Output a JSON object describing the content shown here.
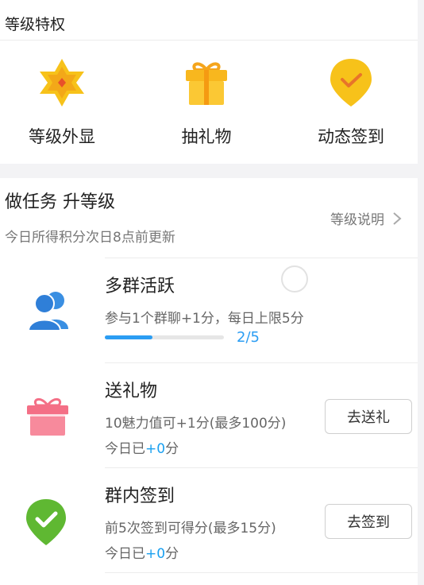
{
  "privileges": {
    "title": "等级特权",
    "items": [
      {
        "label": "等级外显",
        "icon": "star-badge-icon"
      },
      {
        "label": "抽礼物",
        "icon": "gift-box-icon"
      },
      {
        "label": "动态签到",
        "icon": "location-check-icon"
      }
    ]
  },
  "tasks_header": {
    "title": "做任务 升等级",
    "subtitle": "今日所得积分次日8点前更新",
    "level_link": "等级说明"
  },
  "tasks": [
    {
      "name": "多群活跃",
      "desc": "参与1个群聊+1分，每日上限5分",
      "progress_text": "2/5",
      "progress_fraction": 0.4,
      "icon": "users-icon"
    },
    {
      "name": "送礼物",
      "desc": "10魅力值可+1分(最多100分)",
      "today_prefix": "今日已",
      "today_value": "+0",
      "today_suffix": "分",
      "button": "去送礼",
      "icon": "gift-icon"
    },
    {
      "name": "群内签到",
      "desc": "前5次签到可得分(最多15分)",
      "today_prefix": "今日已",
      "today_value": "+0",
      "today_suffix": "分",
      "button": "去签到",
      "icon": "checkin-pin-icon"
    }
  ],
  "colors": {
    "accent": "#2b9df3",
    "gold": "#f7c21a",
    "pink": "#f46f86",
    "green": "#5fb832"
  }
}
